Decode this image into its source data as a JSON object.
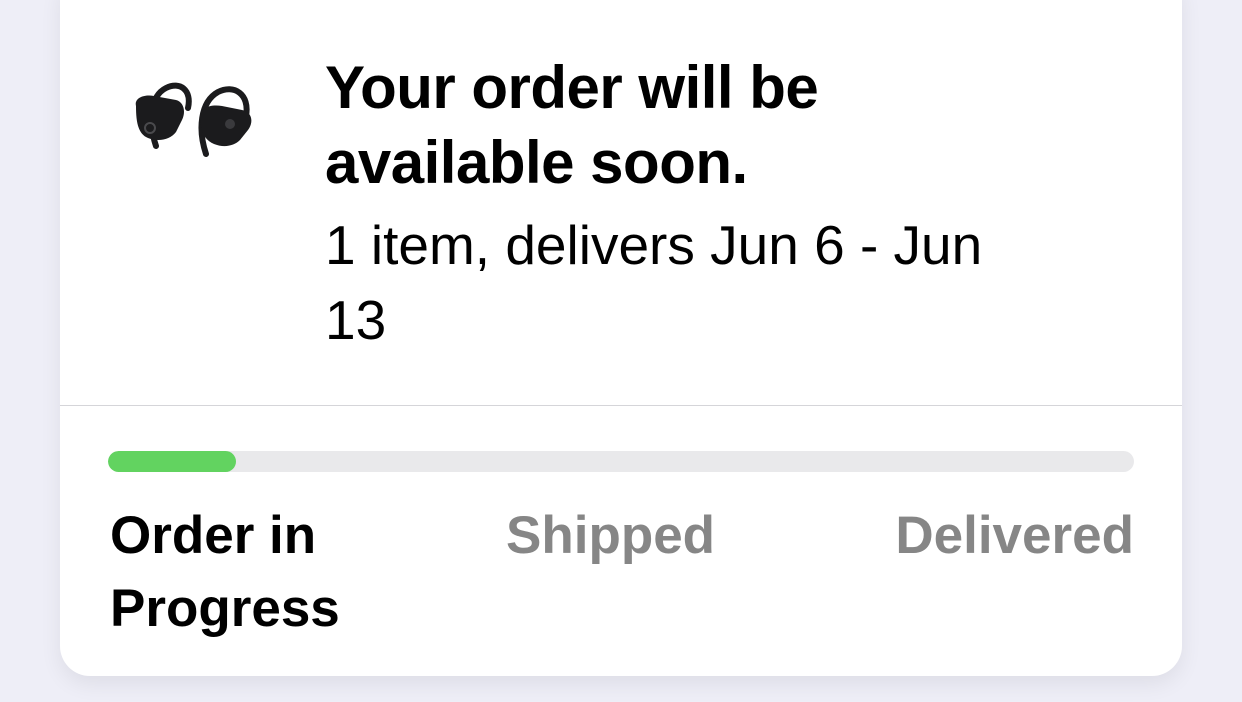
{
  "order": {
    "headline": "Your order will be available soon.",
    "delivery_text": "1 item, delivers Jun 6 - Jun 13",
    "product_image_icon": "earbuds-image"
  },
  "progress": {
    "value_fraction": 0.125,
    "fill_color": "#62d360",
    "track_color": "#e9e9eb"
  },
  "steps": [
    {
      "label": "Order in Progress",
      "state": "current",
      "color": "#000000"
    },
    {
      "label": "Shipped",
      "state": "pending",
      "color": "#868686"
    },
    {
      "label": "Delivered",
      "state": "pending",
      "color": "#868686"
    }
  ]
}
